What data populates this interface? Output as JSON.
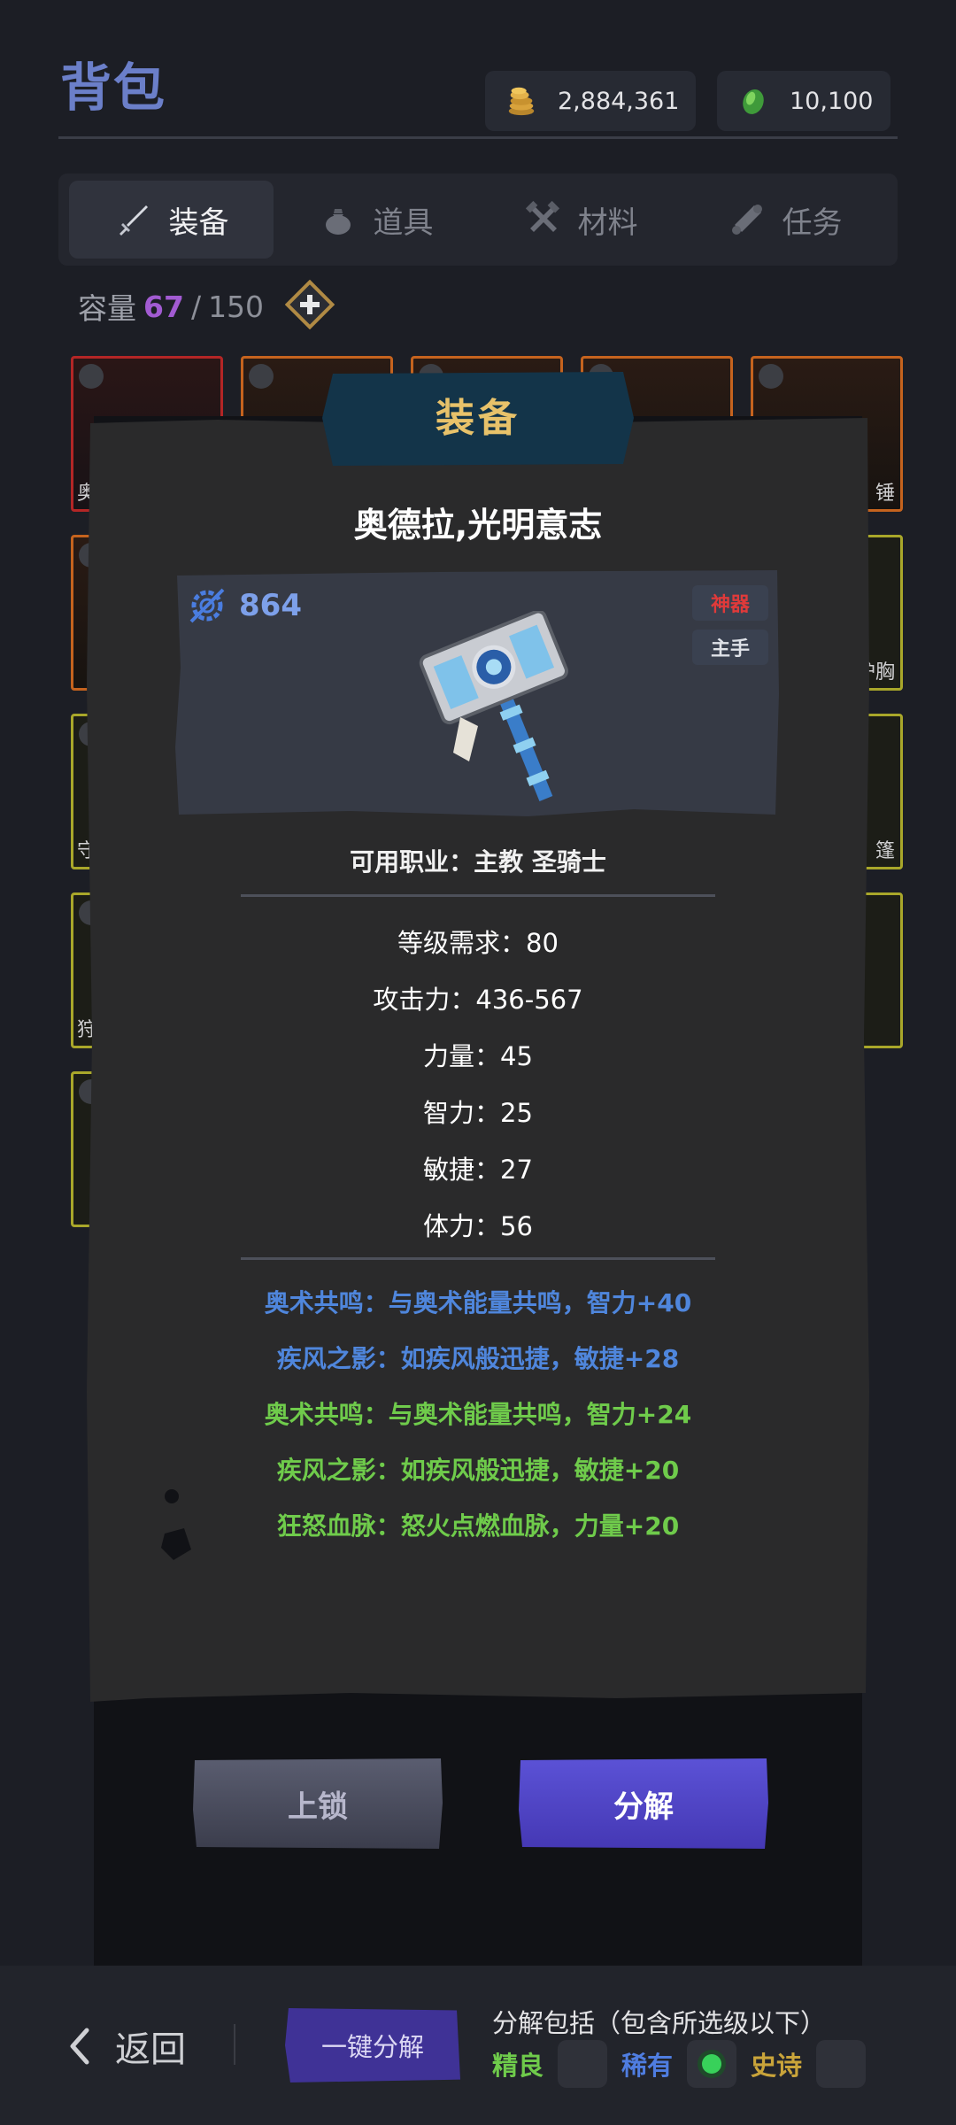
{
  "page": {
    "title": "背包"
  },
  "currency": {
    "gold": "2,884,361",
    "gem": "10,100"
  },
  "tabs": [
    {
      "label": "装备",
      "icon": "sword-icon",
      "active": true
    },
    {
      "label": "道具",
      "icon": "pouch-icon",
      "active": false
    },
    {
      "label": "材料",
      "icon": "tools-icon",
      "active": false
    },
    {
      "label": "任务",
      "icon": "scroll-icon",
      "active": false
    }
  ],
  "capacity": {
    "label": "容量",
    "used": "67",
    "sep": "/",
    "total": "150"
  },
  "grid_labels": {
    "r1c1": "奥",
    "r1c5": "锤",
    "r2c5": "护胸",
    "r3c1": "守",
    "r3c5": "篷",
    "r4c1": "狩"
  },
  "modal": {
    "header": "装备",
    "item_name": "奥德拉,光明意志",
    "power": "864",
    "rarity_tag": "神器",
    "slot_tag": "主手",
    "classes": "可用职业：主教 圣骑士",
    "stats": [
      "等级需求：80",
      "攻击力：436-567",
      "力量：45",
      "智力：25",
      "敏捷：27",
      "体力：56"
    ],
    "affixes": [
      {
        "text": "奥术共鸣：与奥术能量共鸣，智力+40",
        "color": "#4f86dc"
      },
      {
        "text": "疾风之影：如疾风般迅捷，敏捷+28",
        "color": "#4f86dc"
      },
      {
        "text": "奥术共鸣：与奥术能量共鸣，智力+24",
        "color": "#6fcb4b"
      },
      {
        "text": "疾风之影：如疾风般迅捷，敏捷+20",
        "color": "#6fcb4b"
      },
      {
        "text": "狂怒血脉：怒火点燃血脉，力量+20",
        "color": "#6fcb4b"
      }
    ],
    "lock_label": "上锁",
    "decompose_label": "分解"
  },
  "bottom": {
    "back_label": "返回",
    "one_key_label": "一键分解",
    "decomp_title": "分解包括（包含所选级以下）",
    "filters": [
      {
        "label": "精良",
        "color": "#6fcb4b",
        "checked": false
      },
      {
        "label": "稀有",
        "color": "#4f7de0",
        "checked": true
      },
      {
        "label": "史诗",
        "color": "#c9a43a",
        "checked": false
      }
    ]
  },
  "colors": {
    "accent": "#6b7fc9",
    "artifact": "#e03a3a",
    "button_purple": "#5246c4"
  }
}
